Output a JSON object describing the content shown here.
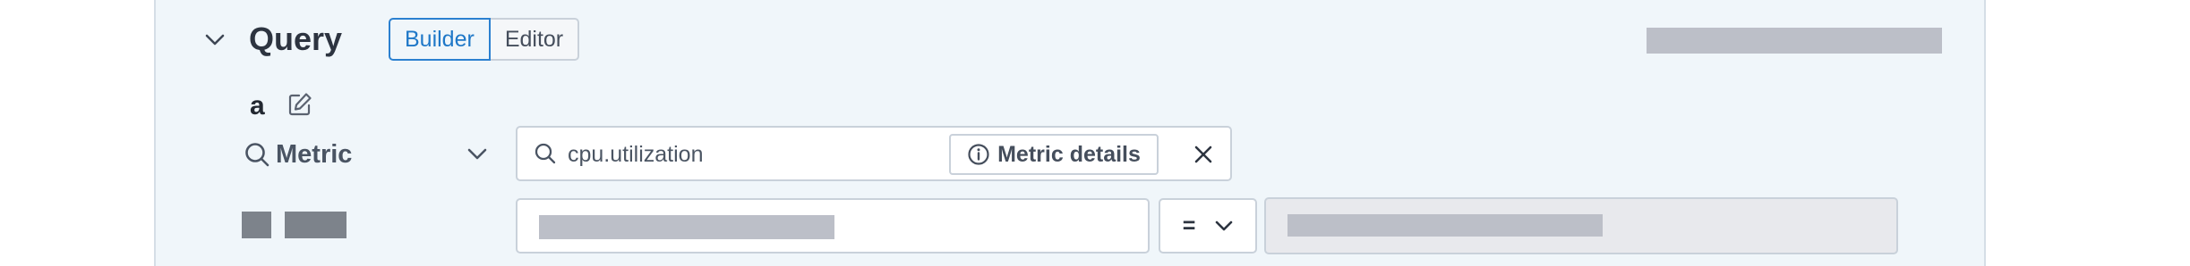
{
  "query": {
    "title": "Query",
    "mode_tabs": [
      {
        "label": "Builder",
        "active": true
      },
      {
        "label": "Editor",
        "active": false
      }
    ],
    "name": "a"
  },
  "metric": {
    "label": "Metric",
    "value": "cpu.utilization",
    "details_label": "Metric details"
  },
  "filter": {
    "operator": "="
  },
  "colors": {
    "panel_bg": "#f0f6fa",
    "accent": "#2b80d0",
    "placeholder": "#bcbfc8",
    "disabled_bg": "#e8e9ed"
  },
  "icons": [
    "chevron-down-icon",
    "edit-icon",
    "search-icon",
    "info-icon",
    "close-icon"
  ]
}
